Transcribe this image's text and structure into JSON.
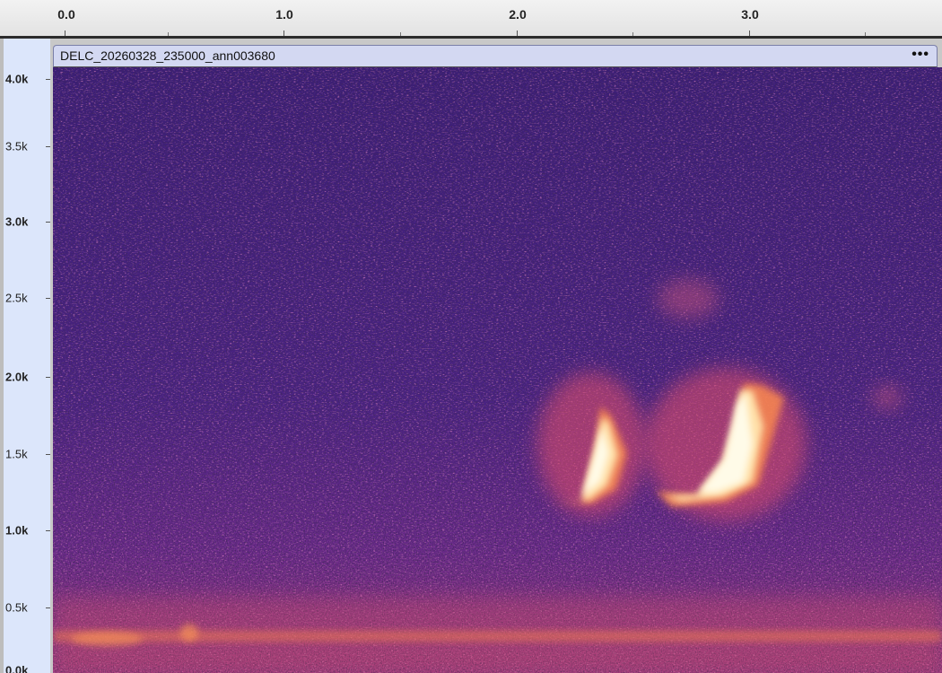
{
  "time_ruler": {
    "labels": [
      "0.0",
      "1.0",
      "2.0",
      "3.0"
    ]
  },
  "frequency_axis": {
    "labels": [
      "4.0k",
      "3.5k",
      "3.0k",
      "2.5k",
      "2.0k",
      "1.5k",
      "1.0k",
      "0.5k",
      "0.0k"
    ]
  },
  "clip": {
    "name": "DELC_20260328_235000_ann003680",
    "menu_label": "•••"
  },
  "colors": {
    "background": "#3a1f7a",
    "axis_panel": "#dce6fb",
    "clip_header": "#d3d8f2",
    "signal": "#fff3d6"
  }
}
